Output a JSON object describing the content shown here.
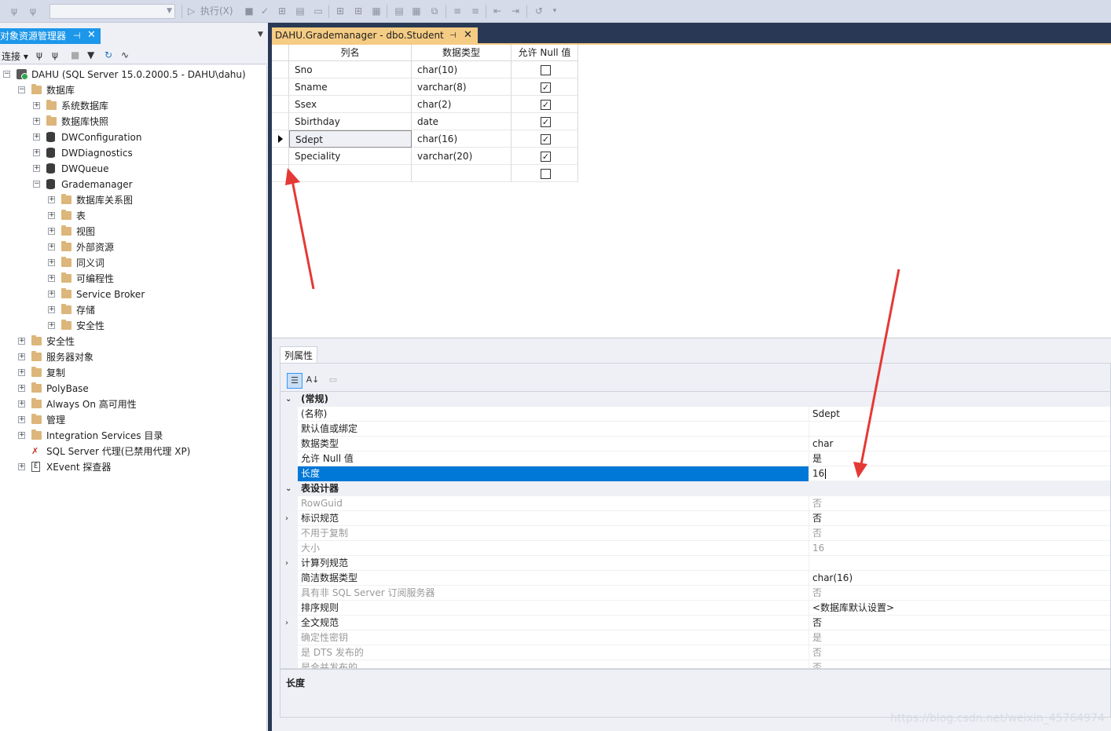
{
  "toolbar": {
    "execute_label": "执行(X)"
  },
  "object_explorer": {
    "title": "对象资源管理器",
    "connect_label": "连接 ▾",
    "tree": [
      {
        "label": "DAHU (SQL Server 15.0.2000.5 - DAHU\\dahu)",
        "icon": "server-icon",
        "level": 0,
        "expander": "−"
      },
      {
        "label": "数据库",
        "icon": "folder-icon",
        "level": 1,
        "expander": "−"
      },
      {
        "label": "系统数据库",
        "icon": "folder-icon",
        "level": 2,
        "expander": "+"
      },
      {
        "label": "数据库快照",
        "icon": "folder-icon",
        "level": 2,
        "expander": "+"
      },
      {
        "label": "DWConfiguration",
        "icon": "database-icon",
        "level": 2,
        "expander": "+"
      },
      {
        "label": "DWDiagnostics",
        "icon": "database-icon",
        "level": 2,
        "expander": "+"
      },
      {
        "label": "DWQueue",
        "icon": "database-icon",
        "level": 2,
        "expander": "+"
      },
      {
        "label": "Grademanager",
        "icon": "database-icon",
        "level": 2,
        "expander": "−"
      },
      {
        "label": "数据库关系图",
        "icon": "folder-icon",
        "level": 3,
        "expander": "+"
      },
      {
        "label": "表",
        "icon": "folder-icon",
        "level": 3,
        "expander": "+"
      },
      {
        "label": "视图",
        "icon": "folder-icon",
        "level": 3,
        "expander": "+"
      },
      {
        "label": "外部资源",
        "icon": "folder-icon",
        "level": 3,
        "expander": "+"
      },
      {
        "label": "同义词",
        "icon": "folder-icon",
        "level": 3,
        "expander": "+"
      },
      {
        "label": "可编程性",
        "icon": "folder-icon",
        "level": 3,
        "expander": "+"
      },
      {
        "label": "Service Broker",
        "icon": "folder-icon",
        "level": 3,
        "expander": "+"
      },
      {
        "label": "存储",
        "icon": "folder-icon",
        "level": 3,
        "expander": "+"
      },
      {
        "label": "安全性",
        "icon": "folder-icon",
        "level": 3,
        "expander": "+"
      },
      {
        "label": "安全性",
        "icon": "folder-icon",
        "level": 1,
        "expander": "+"
      },
      {
        "label": "服务器对象",
        "icon": "folder-icon",
        "level": 1,
        "expander": "+"
      },
      {
        "label": "复制",
        "icon": "folder-icon",
        "level": 1,
        "expander": "+"
      },
      {
        "label": "PolyBase",
        "icon": "folder-icon",
        "level": 1,
        "expander": "+"
      },
      {
        "label": "Always On 高可用性",
        "icon": "folder-icon",
        "level": 1,
        "expander": "+"
      },
      {
        "label": "管理",
        "icon": "folder-icon",
        "level": 1,
        "expander": "+"
      },
      {
        "label": "Integration Services 目录",
        "icon": "folder-icon",
        "level": 1,
        "expander": "+"
      },
      {
        "label": "SQL Server 代理(已禁用代理 XP)",
        "icon": "agent-disabled-icon",
        "level": 1,
        "expander": ""
      },
      {
        "label": "XEvent 探查器",
        "icon": "xevent-icon",
        "level": 1,
        "expander": "+"
      }
    ]
  },
  "document": {
    "tab_title": "DAHU.Grademanager - dbo.Student"
  },
  "designer": {
    "headers": [
      "列名",
      "数据类型",
      "允许 Null 值"
    ],
    "rows": [
      {
        "name": "Sno",
        "type": "char(10)",
        "allow_null": false
      },
      {
        "name": "Sname",
        "type": "varchar(8)",
        "allow_null": true
      },
      {
        "name": "Ssex",
        "type": "char(2)",
        "allow_null": true
      },
      {
        "name": "Sbirthday",
        "type": "date",
        "allow_null": true
      },
      {
        "name": "Sdept",
        "type": "char(16)",
        "allow_null": true,
        "current": true
      },
      {
        "name": "Speciality",
        "type": "varchar(20)",
        "allow_null": true
      },
      {
        "name": "",
        "type": "",
        "allow_null": false
      }
    ]
  },
  "properties": {
    "tab_label": "列属性",
    "rows": [
      {
        "name": "(常规)",
        "value": "",
        "kind": "category"
      },
      {
        "name": "(名称)",
        "value": "Sdept",
        "kind": "normal"
      },
      {
        "name": "默认值或绑定",
        "value": "",
        "kind": "normal"
      },
      {
        "name": "数据类型",
        "value": "char",
        "kind": "normal"
      },
      {
        "name": "允许 Null 值",
        "value": "是",
        "kind": "normal"
      },
      {
        "name": "长度",
        "value": "16",
        "kind": "selected"
      },
      {
        "name": "表设计器",
        "value": "",
        "kind": "category"
      },
      {
        "name": "RowGuid",
        "value": "否",
        "kind": "dim"
      },
      {
        "name": "标识规范",
        "value": "否",
        "kind": "expandable"
      },
      {
        "name": "不用于复制",
        "value": "否",
        "kind": "dim"
      },
      {
        "name": "大小",
        "value": "16",
        "kind": "dim"
      },
      {
        "name": "计算列规范",
        "value": "",
        "kind": "expandable"
      },
      {
        "name": "简洁数据类型",
        "value": "char(16)",
        "kind": "normal"
      },
      {
        "name": "具有非 SQL Server 订阅服务器",
        "value": "否",
        "kind": "dim"
      },
      {
        "name": "排序规则",
        "value": "<数据库默认设置>",
        "kind": "normal"
      },
      {
        "name": "全文规范",
        "value": "否",
        "kind": "expandable"
      },
      {
        "name": "确定性密钥",
        "value": "是",
        "kind": "dim"
      },
      {
        "name": "是 DTS 发布的",
        "value": "否",
        "kind": "dim"
      },
      {
        "name": "是合并发布的",
        "value": "否",
        "kind": "dim"
      }
    ],
    "description_title": "长度"
  },
  "watermark": "https://blog.csdn.net/weixin_45764974"
}
